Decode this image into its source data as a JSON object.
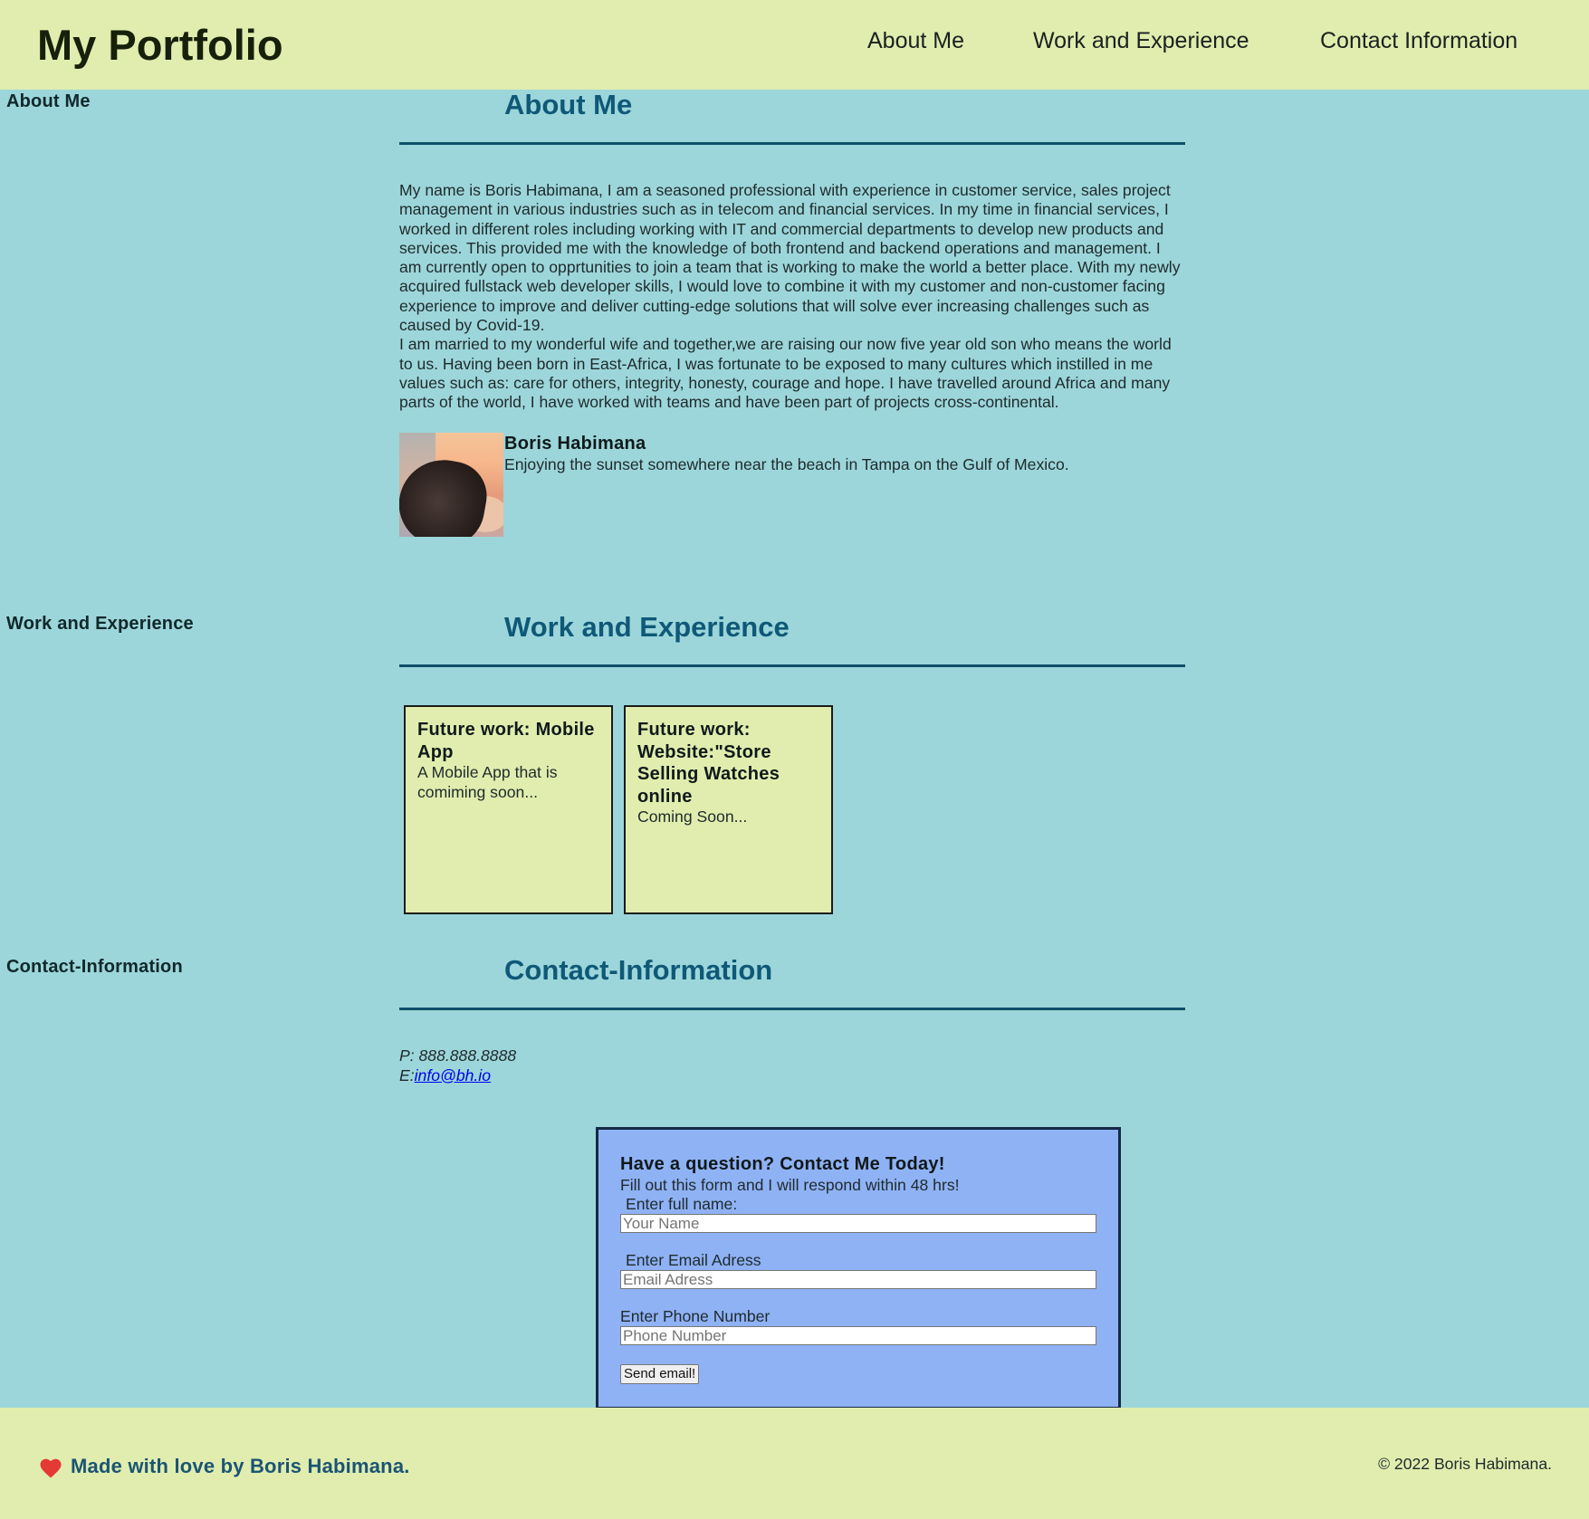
{
  "header": {
    "brand": "My Portfolio",
    "nav": {
      "about": "About Me",
      "work": "Work and Experience",
      "contact": "Contact Information"
    }
  },
  "about": {
    "side_label": "About Me",
    "heading": "About Me",
    "paragraph_1": "My name is Boris Habimana, I am a seasoned professional with experience in customer service, sales project management in various industries such as in telecom and financial services. In my time in financial services, I worked in different roles including working with IT and commercial departments to develop new products and services. This provided me with the knowledge of both frontend and backend operations and management. I am currently open to opprtunities to join a team that is working to make the world a better place. With my newly acquired fullstack web developer skills, I would love to combine it with my customer and non-customer facing experience to improve and deliver cutting-edge solutions that will solve ever increasing challenges such as caused by Covid-19.",
    "paragraph_2": "I am married to my wonderful wife and together,we are raising our now five year old son who means the world to us. Having been born in East-Africa, I was fortunate to be exposed to many cultures which instilled in me values such as: care for others, integrity, honesty, courage and hope. I have travelled around Africa and many parts of the world, I have worked with teams and have been part of projects cross-continental.",
    "caption_name": "Boris Habimana",
    "caption_text": "Enjoying the sunset somewhere near the beach in Tampa on the Gulf of Mexico."
  },
  "work": {
    "side_label": "Work and Experience",
    "heading": "Work and Experience",
    "cards": [
      {
        "title": "Future work: Mobile App",
        "description": "A Mobile App that is comiming soon..."
      },
      {
        "title": "Future work: Website:\"Store Selling Watches online",
        "description": "Coming Soon..."
      }
    ]
  },
  "contact": {
    "side_label": "Contact-Information",
    "heading": "Contact-Information",
    "phone_line": "P: 888.888.8888",
    "email_prefix": "E:",
    "email": "info@bh.io",
    "form": {
      "title": "Have a question? Contact Me Today!",
      "subtitle": "Fill out this form and I will respond within 48 hrs!",
      "name_label": "Enter full name:",
      "name_placeholder": "Your Name",
      "email_label": "Enter Email Adress",
      "email_placeholder": "Email Adress",
      "phone_label": "Enter Phone Number",
      "phone_placeholder": "Phone Number",
      "submit_label": "Send email!"
    }
  },
  "footer": {
    "love_text": "Made with love by Boris Habimana.",
    "copyright": "© 2022 Boris Habimana."
  },
  "colors": {
    "page_background": "#9cd6da",
    "header_footer_background": "#e0edae",
    "heading": "#0f5878",
    "form_background": "#8fb2f5",
    "heart": "#e53935",
    "link": "#0000ee"
  },
  "icons": {
    "footer_heart": "heart-icon"
  }
}
